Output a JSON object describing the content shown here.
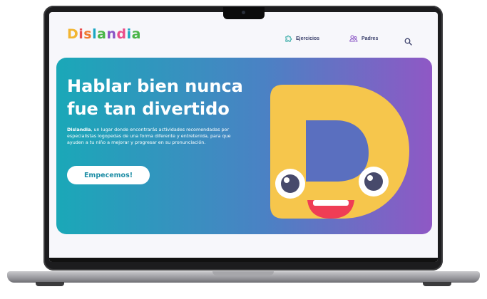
{
  "brand": {
    "letters": [
      {
        "char": "D",
        "color": "#f2b531"
      },
      {
        "char": "i",
        "color": "#e94e4e"
      },
      {
        "char": "s",
        "color": "#f07b2e"
      },
      {
        "char": "l",
        "color": "#1ba6c2"
      },
      {
        "char": "a",
        "color": "#4ab548"
      },
      {
        "char": "n",
        "color": "#8a54c4"
      },
      {
        "char": "d",
        "color": "#e94e8a"
      },
      {
        "char": "i",
        "color": "#1ba6c2"
      },
      {
        "char": "a",
        "color": "#4ab548"
      }
    ]
  },
  "nav": {
    "exercises_label": "Ejercicios",
    "parents_label": "Padres",
    "search_icon": "search-icon"
  },
  "hero": {
    "title_line1": "Hablar bien nunca",
    "title_line2": "fue tan divertido",
    "desc_brand": "Dislandia",
    "desc_text": ", un lugar donde encontrarás actividades recomendadas por especialistas logopedas de una forma diferente y entretenida, para que ayuden a tu niño a mejorar y progresar en su pronunciación.",
    "cta_label": "Empecemos!",
    "mascot_letter": "D"
  },
  "colors": {
    "gradient_start": "#1aa8b8",
    "gradient_end": "#8f58c5",
    "mascot_yellow": "#f6c64c",
    "mouth_red": "#ef3d55"
  }
}
